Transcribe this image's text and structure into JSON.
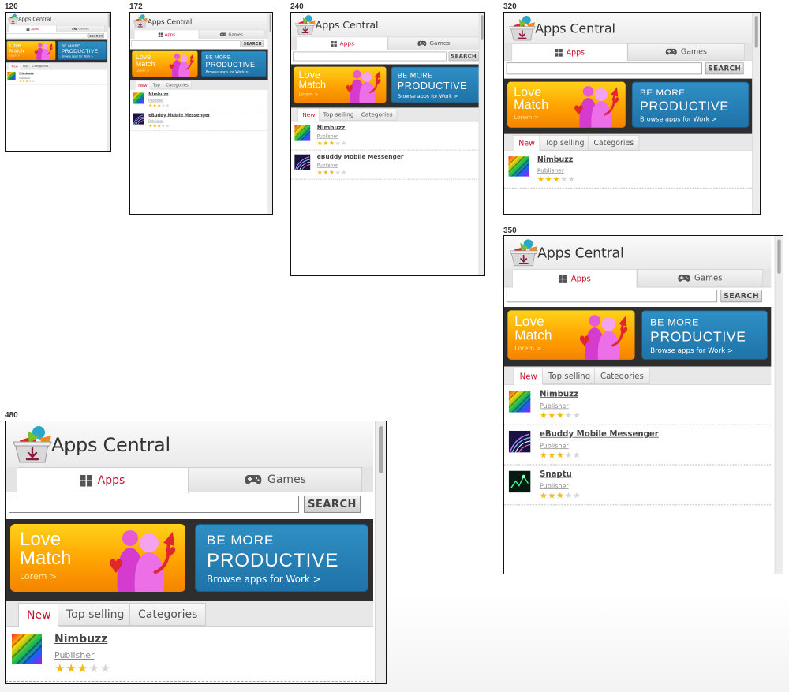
{
  "widths": [
    "120",
    "172",
    "240",
    "320",
    "350",
    "480"
  ],
  "app": {
    "title": "Apps Central",
    "nav": {
      "apps_label": "Apps",
      "games_label": "Games",
      "apps_icon": "grid-icon",
      "games_icon": "gamepad-icon"
    },
    "search": {
      "placeholder": "",
      "button_label": "SEARCH"
    },
    "banners": {
      "love": {
        "line1": "Love",
        "line2": "Match",
        "sub": "Lorem >"
      },
      "productive": {
        "line1": "BE MORE",
        "line2": "PRODUCTIVE",
        "sub": "Browse apps for Work  >"
      }
    },
    "list_tabs_full": [
      "New",
      "Top selling",
      "Categories"
    ],
    "list_tabs_short": [
      "New",
      "Top",
      "Categories"
    ],
    "apps": [
      {
        "name": "Nimbuzz",
        "publisher": "Publisher",
        "rating": 3,
        "max": 5
      },
      {
        "name": "eBuddy Mobile Messenger",
        "publisher": "Publisher",
        "rating": 3,
        "max": 5
      },
      {
        "name": "Snaptu",
        "publisher": "Publisher",
        "rating": 3,
        "max": 5
      }
    ],
    "colors": {
      "accent_red": "#c8102e",
      "banner_orange": "#ffa200",
      "banner_blue": "#1f73a8",
      "star_gold": "#f2b90d"
    }
  }
}
